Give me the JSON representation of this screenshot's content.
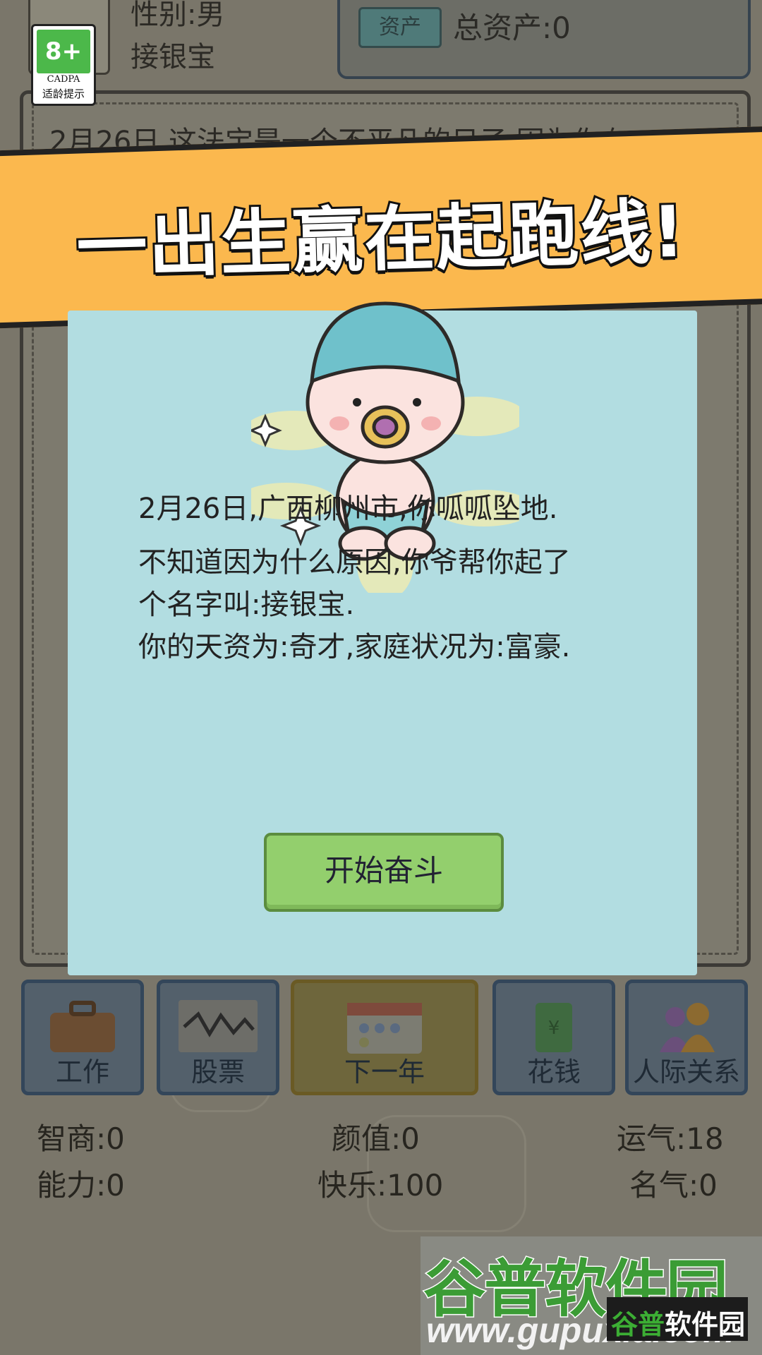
{
  "header": {
    "gender": "性别:男",
    "name": "接银宝",
    "asset_tag": "资产",
    "asset_total": "总资产:0"
  },
  "age_badge": {
    "rating": "8+",
    "org": "CADPA",
    "label": "适龄提示"
  },
  "log": {
    "first_line": "2月26日,这法宝是一个不平凡的日子,因为你在"
  },
  "banner": {
    "text": "一出生赢在起跑线!"
  },
  "dialog": {
    "line1": "2月26日,广西柳州市,你呱呱坠地.",
    "line2": "不知道因为什么原因,你爷帮你起了",
    "line3": "个名字叫:接银宝.",
    "line4": "你的天资为:奇才,家庭状况为:富豪.",
    "button": "开始奋斗"
  },
  "menu": {
    "work": "工作",
    "stocks": "股票",
    "next_year": "下一年",
    "spend": "花钱",
    "relations": "人际关系"
  },
  "stats": {
    "iq": "智商:0",
    "looks": "颜值:0",
    "luck": "运气:18",
    "ability": "能力:0",
    "happiness": "快乐:100",
    "fame": "名气:0"
  },
  "watermark": {
    "title": "谷普软件园",
    "url": "www.gupuxia.com",
    "corner_a": "谷普",
    "corner_b": "软件园"
  },
  "colors": {
    "banner": "#fbb84e",
    "dialog": "#b2dde1",
    "button": "#93cf6d",
    "overlay": "#7a766a"
  }
}
